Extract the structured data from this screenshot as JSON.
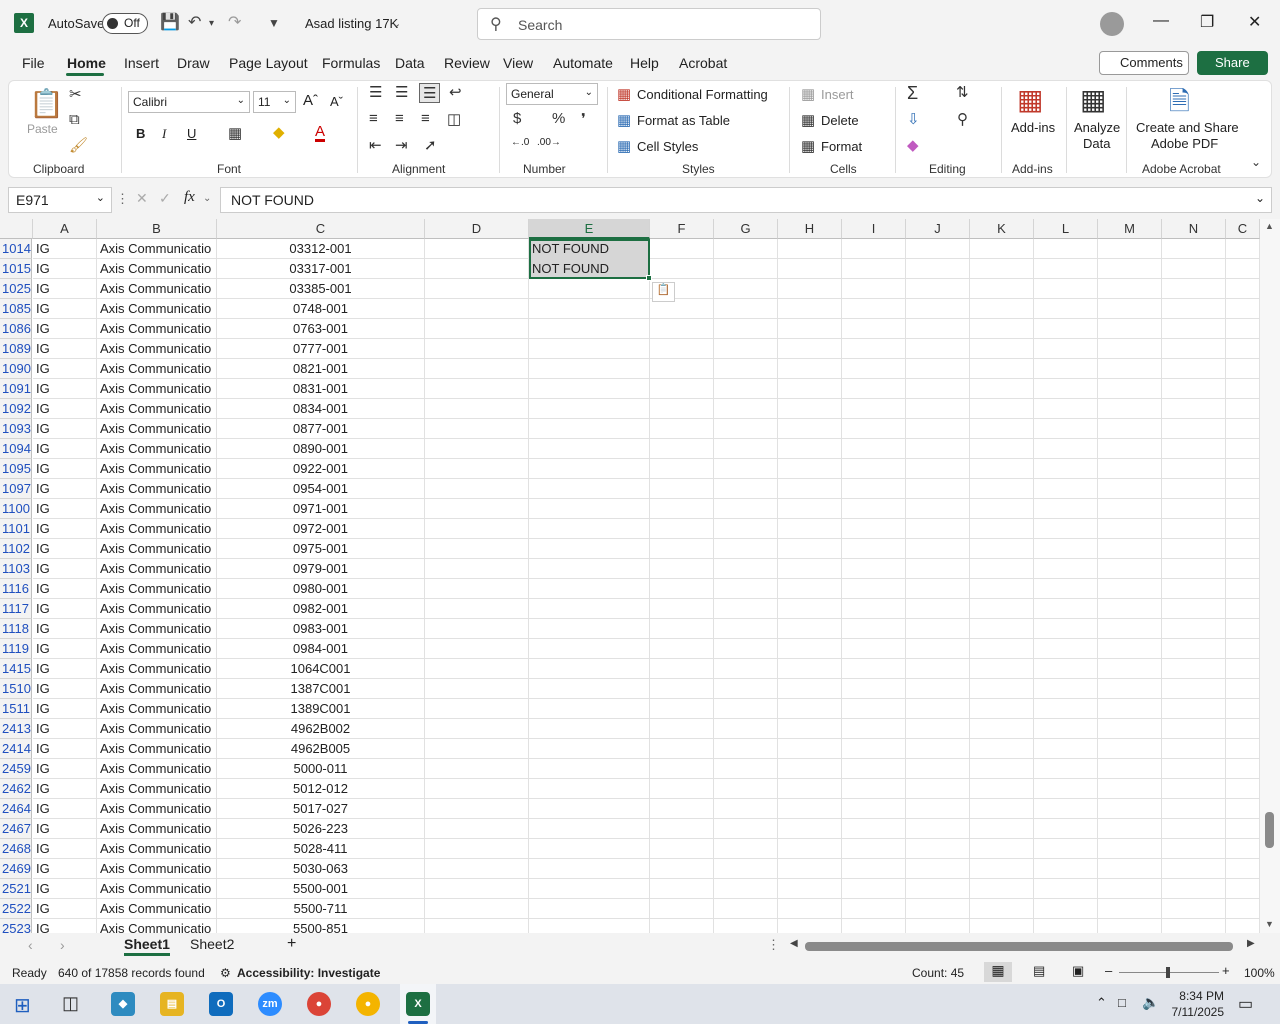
{
  "titlebar": {
    "autosave_label": "AutoSave",
    "autosave_state": "Off",
    "file_title": "Asad listing 17K",
    "search_placeholder": "Search"
  },
  "tabs": [
    "File",
    "Home",
    "Insert",
    "Draw",
    "Page Layout",
    "Formulas",
    "Data",
    "Review",
    "View",
    "Automate",
    "Help",
    "Acrobat"
  ],
  "active_tab": "Home",
  "comments_label": "Comments",
  "share_label": "Share",
  "ribbon": {
    "clipboard": {
      "paste": "Paste",
      "label": "Clipboard"
    },
    "font": {
      "name": "Calibri",
      "size": "11",
      "label": "Font"
    },
    "alignment": {
      "label": "Alignment"
    },
    "number": {
      "format": "General",
      "label": "Number"
    },
    "styles": {
      "conditional": "Conditional Formatting",
      "format_table": "Format as Table",
      "cell_styles": "Cell Styles",
      "label": "Styles"
    },
    "cells": {
      "insert": "Insert",
      "delete": "Delete",
      "format": "Format",
      "label": "Cells"
    },
    "editing": {
      "label": "Editing"
    },
    "addins": {
      "addins": "Add-ins",
      "label": "Add-ins"
    },
    "analyze": {
      "line1": "Analyze",
      "line2": "Data"
    },
    "acrobat": {
      "line1": "Create and Share",
      "line2": "Adobe PDF",
      "label": "Adobe Acrobat"
    }
  },
  "formula_bar": {
    "name_box": "E971",
    "fx": "fx",
    "formula": "NOT FOUND"
  },
  "columns": [
    "A",
    "B",
    "C",
    "D",
    "E",
    "F",
    "G",
    "H",
    "I",
    "J",
    "K",
    "L",
    "M",
    "N",
    "C"
  ],
  "rows": [
    {
      "num": "1014",
      "a": "IG",
      "b": "Axis Communicatio",
      "c": "03312-001",
      "e": "NOT FOUND"
    },
    {
      "num": "1015",
      "a": "IG",
      "b": "Axis Communicatio",
      "c": "03317-001",
      "e": "NOT FOUND"
    },
    {
      "num": "1025",
      "a": "IG",
      "b": "Axis Communicatio",
      "c": "03385-001",
      "e": ""
    },
    {
      "num": "1085",
      "a": "IG",
      "b": "Axis Communicatio",
      "c": "0748-001",
      "e": ""
    },
    {
      "num": "1086",
      "a": "IG",
      "b": "Axis Communicatio",
      "c": "0763-001",
      "e": ""
    },
    {
      "num": "1089",
      "a": "IG",
      "b": "Axis Communicatio",
      "c": "0777-001",
      "e": ""
    },
    {
      "num": "1090",
      "a": "IG",
      "b": "Axis Communicatio",
      "c": "0821-001",
      "e": ""
    },
    {
      "num": "1091",
      "a": "IG",
      "b": "Axis Communicatio",
      "c": "0831-001",
      "e": ""
    },
    {
      "num": "1092",
      "a": "IG",
      "b": "Axis Communicatio",
      "c": "0834-001",
      "e": ""
    },
    {
      "num": "1093",
      "a": "IG",
      "b": "Axis Communicatio",
      "c": "0877-001",
      "e": ""
    },
    {
      "num": "1094",
      "a": "IG",
      "b": "Axis Communicatio",
      "c": "0890-001",
      "e": ""
    },
    {
      "num": "1095",
      "a": "IG",
      "b": "Axis Communicatio",
      "c": "0922-001",
      "e": ""
    },
    {
      "num": "1097",
      "a": "IG",
      "b": "Axis Communicatio",
      "c": "0954-001",
      "e": ""
    },
    {
      "num": "1100",
      "a": "IG",
      "b": "Axis Communicatio",
      "c": "0971-001",
      "e": ""
    },
    {
      "num": "1101",
      "a": "IG",
      "b": "Axis Communicatio",
      "c": "0972-001",
      "e": ""
    },
    {
      "num": "1102",
      "a": "IG",
      "b": "Axis Communicatio",
      "c": "0975-001",
      "e": ""
    },
    {
      "num": "1103",
      "a": "IG",
      "b": "Axis Communicatio",
      "c": "0979-001",
      "e": ""
    },
    {
      "num": "1116",
      "a": "IG",
      "b": "Axis Communicatio",
      "c": "0980-001",
      "e": ""
    },
    {
      "num": "1117",
      "a": "IG",
      "b": "Axis Communicatio",
      "c": "0982-001",
      "e": ""
    },
    {
      "num": "1118",
      "a": "IG",
      "b": "Axis Communicatio",
      "c": "0983-001",
      "e": ""
    },
    {
      "num": "1119",
      "a": "IG",
      "b": "Axis Communicatio",
      "c": "0984-001",
      "e": ""
    },
    {
      "num": "1415",
      "a": "IG",
      "b": "Axis Communicatio",
      "c": "1064C001",
      "e": ""
    },
    {
      "num": "1510",
      "a": "IG",
      "b": "Axis Communicatio",
      "c": "1387C001",
      "e": ""
    },
    {
      "num": "1511",
      "a": "IG",
      "b": "Axis Communicatio",
      "c": "1389C001",
      "e": ""
    },
    {
      "num": "2413",
      "a": "IG",
      "b": "Axis Communicatio",
      "c": "4962B002",
      "e": ""
    },
    {
      "num": "2414",
      "a": "IG",
      "b": "Axis Communicatio",
      "c": "4962B005",
      "e": ""
    },
    {
      "num": "2459",
      "a": "IG",
      "b": "Axis Communicatio",
      "c": "5000-011",
      "e": ""
    },
    {
      "num": "2462",
      "a": "IG",
      "b": "Axis Communicatio",
      "c": "5012-012",
      "e": ""
    },
    {
      "num": "2464",
      "a": "IG",
      "b": "Axis Communicatio",
      "c": "5017-027",
      "e": ""
    },
    {
      "num": "2467",
      "a": "IG",
      "b": "Axis Communicatio",
      "c": "5026-223",
      "e": ""
    },
    {
      "num": "2468",
      "a": "IG",
      "b": "Axis Communicatio",
      "c": "5028-411",
      "e": ""
    },
    {
      "num": "2469",
      "a": "IG",
      "b": "Axis Communicatio",
      "c": "5030-063",
      "e": ""
    },
    {
      "num": "2521",
      "a": "IG",
      "b": "Axis Communicatio",
      "c": "5500-001",
      "e": ""
    },
    {
      "num": "2522",
      "a": "IG",
      "b": "Axis Communicatio",
      "c": "5500-711",
      "e": ""
    },
    {
      "num": "2523",
      "a": "IG",
      "b": "Axis Communicatio",
      "c": "5500-851",
      "e": ""
    }
  ],
  "sheets": [
    "Sheet1",
    "Sheet2"
  ],
  "active_sheet": "Sheet1",
  "status": {
    "ready": "Ready",
    "records": "640 of 17858 records found",
    "accessibility": "Accessibility: Investigate",
    "count": "Count: 45",
    "zoom": "100%"
  },
  "taskbar": {
    "time": "8:34 PM",
    "date": "7/11/2025"
  },
  "colors": {
    "excel_green": "#1d6f42",
    "row_number_blue": "#1f4fbf"
  }
}
